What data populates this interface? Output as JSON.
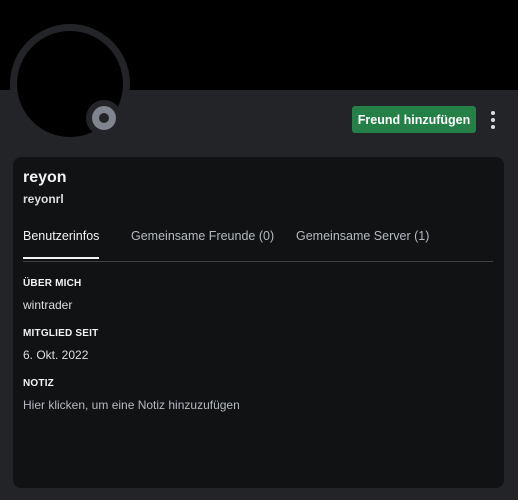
{
  "profile": {
    "display_name": "reyon",
    "username": "reyonrl",
    "status": "offline",
    "banner_color": "#000000",
    "accent_color": "#248046"
  },
  "actions": {
    "add_friend_label": "Freund hinzufügen",
    "more_icon": "more-vertical-icon"
  },
  "tabs": [
    {
      "label": "Benutzerinfos",
      "active": true
    },
    {
      "label": "Gemeinsame Freunde (0)",
      "active": false
    },
    {
      "label": "Gemeinsame Server (1)",
      "active": false
    }
  ],
  "sections": {
    "about": {
      "title": "ÜBER MICH",
      "text": "wintrader"
    },
    "member_since": {
      "title": "MITGLIED SEIT",
      "text": "6. Okt. 2022"
    },
    "note": {
      "title": "NOTIZ",
      "placeholder": "Hier klicken, um eine Notiz hinzuzufügen"
    }
  }
}
